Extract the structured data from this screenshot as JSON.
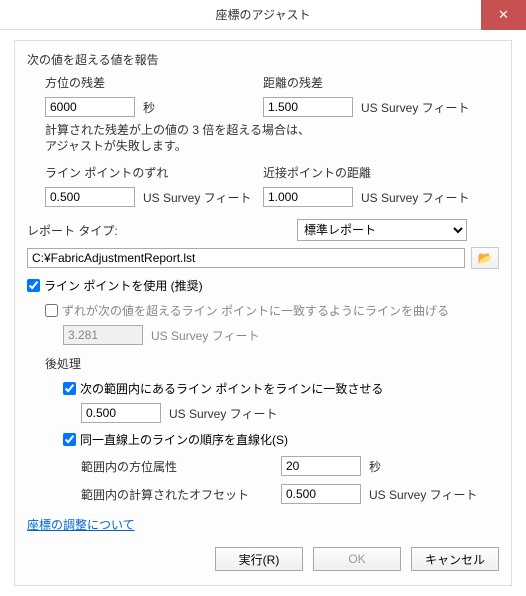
{
  "title": "座標のアジャスト",
  "section_report_values": "次の値を超える値を報告",
  "bearing_residual_label": "方位の残差",
  "bearing_residual_value": "6000",
  "bearing_residual_unit": "秒",
  "distance_residual_label": "距離の残差",
  "distance_residual_value": "1.500",
  "distance_residual_unit": "US Survey フィート",
  "residual_note": "計算された残差が上の値の 3 倍を超える場合は、\nアジャストが失敗します。",
  "line_point_offset_label": "ライン ポイントのずれ",
  "line_point_offset_value": "0.500",
  "line_point_offset_unit": "US Survey フィート",
  "close_point_distance_label": "近接ポイントの距離",
  "close_point_distance_value": "1.000",
  "close_point_distance_unit": "US Survey フィート",
  "report_type_label": "レポート タイプ:",
  "report_type_value": "標準レポート",
  "report_path": "C:¥FabricAdjustmentReport.lst",
  "use_line_points_label": "ライン ポイントを使用 (推奨)",
  "bend_lines_label": "ずれが次の値を超えるライン ポイントに一致するようにラインを曲げる",
  "bend_lines_value": "3.281",
  "bend_lines_unit": "US Survey フィート",
  "post_processing_label": "後処理",
  "snap_line_points_label": "次の範囲内にあるライン ポイントをラインに一致させる",
  "snap_line_points_value": "0.500",
  "snap_line_points_unit": "US Survey フィート",
  "straighten_label": "同一直線上のラインの順序を直線化(S)",
  "bearing_attr_label": "範囲内の方位属性",
  "bearing_attr_value": "20",
  "bearing_attr_unit": "秒",
  "computed_offset_label": "範囲内の計算されたオフセット",
  "computed_offset_value": "0.500",
  "computed_offset_unit": "US Survey フィート",
  "about_link": "座標の調整について",
  "run_btn": "実行(R)",
  "ok_btn": "OK",
  "cancel_btn": "キャンセル"
}
